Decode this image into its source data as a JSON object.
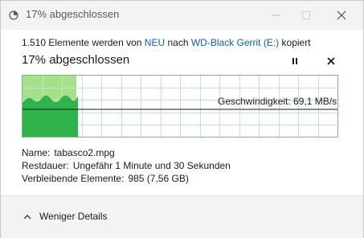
{
  "window": {
    "title": "17% abgeschlossen",
    "icon": "copy-progress-icon"
  },
  "summary": {
    "count_text": "1.510 Elemente werden von",
    "source": "NEU",
    "middle": "nach",
    "destination": "WD-Black Gerrit (E:)",
    "suffix": "kopiert"
  },
  "progress": {
    "heading": "17% abgeschlossen",
    "percent": 17
  },
  "graph": {
    "speed_label": "Geschwindigkeit: 69,1 MB/s",
    "fill_color": "#2fb34a",
    "bg_progress_color": "#a6e089",
    "grid_color": "#bfe7c7"
  },
  "details": {
    "name_label": "Name:",
    "name_value": "tabasco2.mpg",
    "remaining_time_label": "Restdauer:",
    "remaining_time_value": "Ungefähr 1 Minute und 30 Sekunden",
    "remaining_items_label": "Verbleibende Elemente:",
    "remaining_items_value": "985 (7,56 GB)"
  },
  "footer": {
    "fewer_details_label": "Weniger Details"
  }
}
